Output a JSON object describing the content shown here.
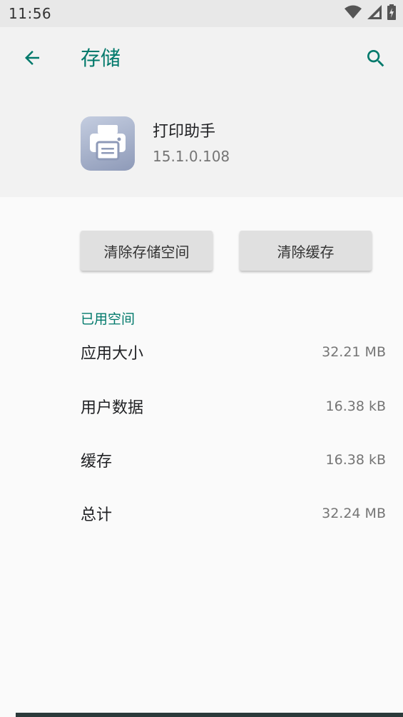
{
  "status_bar": {
    "time": "11:56",
    "icons": [
      "wifi-icon",
      "signal-icon",
      "battery-icon"
    ]
  },
  "toolbar": {
    "title": "存储",
    "back_icon": "arrow-back-icon",
    "search_icon": "search-icon"
  },
  "app": {
    "name": "打印助手",
    "version": "15.1.0.108",
    "icon": "printer-icon"
  },
  "buttons": {
    "clear_storage": "清除存储空间",
    "clear_cache": "清除缓存"
  },
  "storage": {
    "section_title": "已用空间",
    "rows": [
      {
        "label": "应用大小",
        "value": "32.21 MB"
      },
      {
        "label": "用户数据",
        "value": "16.38 kB"
      },
      {
        "label": "缓存",
        "value": "16.38 kB"
      },
      {
        "label": "总计",
        "value": "32.24 MB"
      }
    ]
  },
  "colors": {
    "accent": "#00796b",
    "header_bg": "#f2f2f2",
    "page_bg": "#fafafa",
    "button_bg": "#e0e0e0"
  }
}
